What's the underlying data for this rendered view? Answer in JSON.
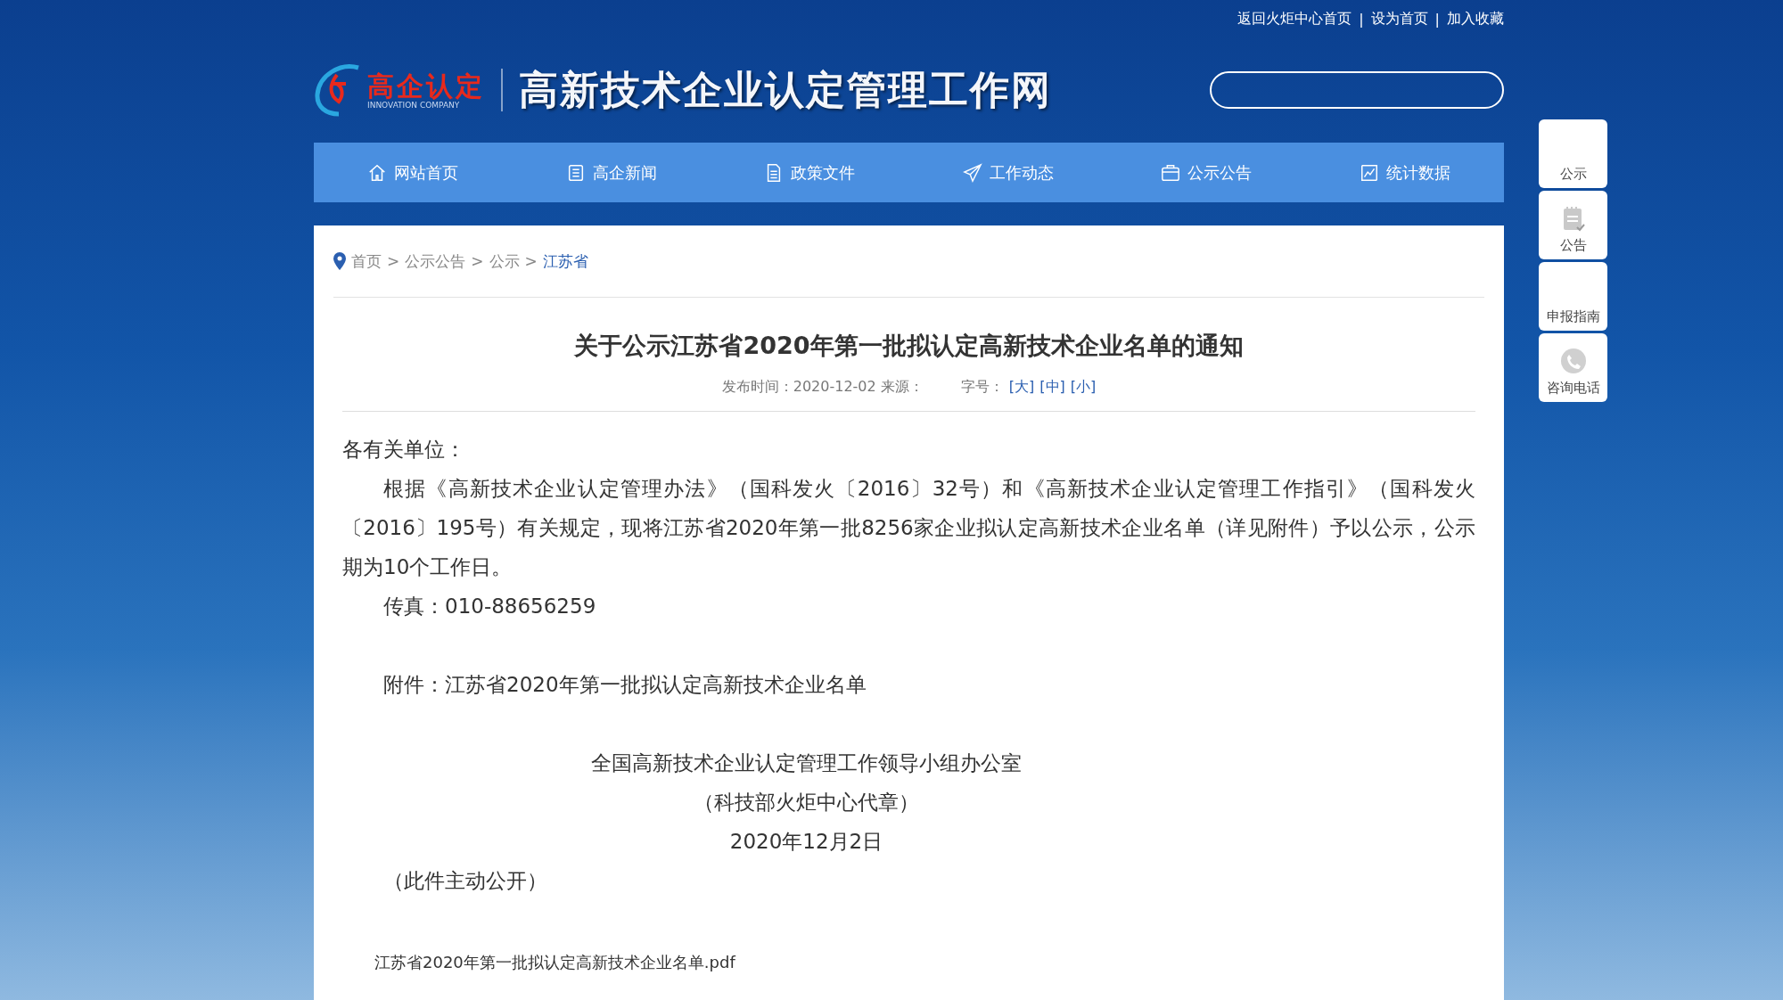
{
  "top_links": [
    "返回火炬中心首页",
    "设为首页",
    "加入收藏"
  ],
  "top_link_separators": [
    "|",
    "|"
  ],
  "breadcrumb_separators": [
    ">",
    ">",
    ">"
  ],
  "logo": {
    "mark": "高企认定",
    "subtitle": "INNOVATION COMPANY"
  },
  "site_title": "高新技术企业认定管理工作网",
  "nav": [
    {
      "label": "网站首页"
    },
    {
      "label": "高企新闻"
    },
    {
      "label": "政策文件"
    },
    {
      "label": "工作动态"
    },
    {
      "label": "公示公告"
    },
    {
      "label": "统计数据"
    }
  ],
  "side_widgets": [
    {
      "label": "公示"
    },
    {
      "label": "公告"
    },
    {
      "label": "申报指南"
    },
    {
      "label": "咨询电话"
    }
  ],
  "breadcrumb": [
    {
      "label": "首页",
      "selected": false
    },
    {
      "label": "公示公告",
      "selected": false
    },
    {
      "label": "公示",
      "selected": false
    },
    {
      "label": "江苏省",
      "selected": true
    }
  ],
  "article": {
    "title": "关于公示江苏省2020年第一批拟认定高新技术企业名单的通知",
    "meta": {
      "published": "发布时间：2020-12-02 来源：",
      "font_label": "字号：",
      "font_sizes": [
        "[大]",
        "[中]",
        "[小]"
      ]
    },
    "sections": [
      [
        {
          "kind": "plain",
          "text": "各有关单位："
        },
        {
          "kind": "indent",
          "text": "根据《高新技术企业认定管理办法》（国科发火〔2016〕32号）和《高新技术企业认定管理工作指引》（国科发火〔2016〕195号）有关规定，现将江苏省2020年第一批8256家企业拟认定高新技术企业名单（详见附件）予以公示，公示期为10个工作日。"
        },
        {
          "kind": "indent",
          "text": "传真：010-88656259"
        }
      ],
      [
        {
          "kind": "indent",
          "text": "附件：江苏省2020年第一批拟认定高新技术企业名单"
        }
      ],
      [
        {
          "kind": "center",
          "text": "全国高新技术企业认定管理工作领导小组办公室"
        },
        {
          "kind": "center",
          "text": "（科技部火炬中心代章）"
        },
        {
          "kind": "center",
          "text": "2020年12月2日"
        },
        {
          "kind": "indent",
          "text": "（此件主动公开）"
        }
      ]
    ],
    "attachment": "江苏省2020年第一批拟认定高新技术企业名单.pdf"
  }
}
